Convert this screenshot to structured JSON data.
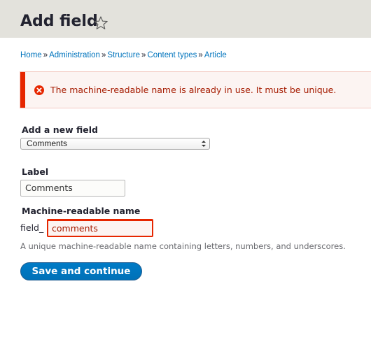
{
  "header": {
    "title": "Add field",
    "shortcut_icon": "star-outline-icon"
  },
  "breadcrumb": {
    "items": [
      "Home",
      "Administration",
      "Structure",
      "Content types",
      "Article"
    ],
    "separator": "»"
  },
  "messages": {
    "error": {
      "icon": "error-circle-x-icon",
      "text": "The machine-readable name is already in use. It must be unique.",
      "accent_color": "#e62600",
      "text_color": "#a51b00"
    }
  },
  "form": {
    "add_new_field": {
      "label": "Add a new field",
      "selected": "Comments"
    },
    "label_field": {
      "label": "Label",
      "value": "Comments"
    },
    "machine_name": {
      "label": "Machine-readable name",
      "prefix": "field_",
      "value": "comments",
      "description": "A unique machine-readable name containing letters, numbers, and underscores."
    },
    "submit_label": "Save and continue"
  },
  "colors": {
    "header_bg": "#e3e2dc",
    "link": "#0074bd",
    "primary_button": "#0074bd"
  }
}
